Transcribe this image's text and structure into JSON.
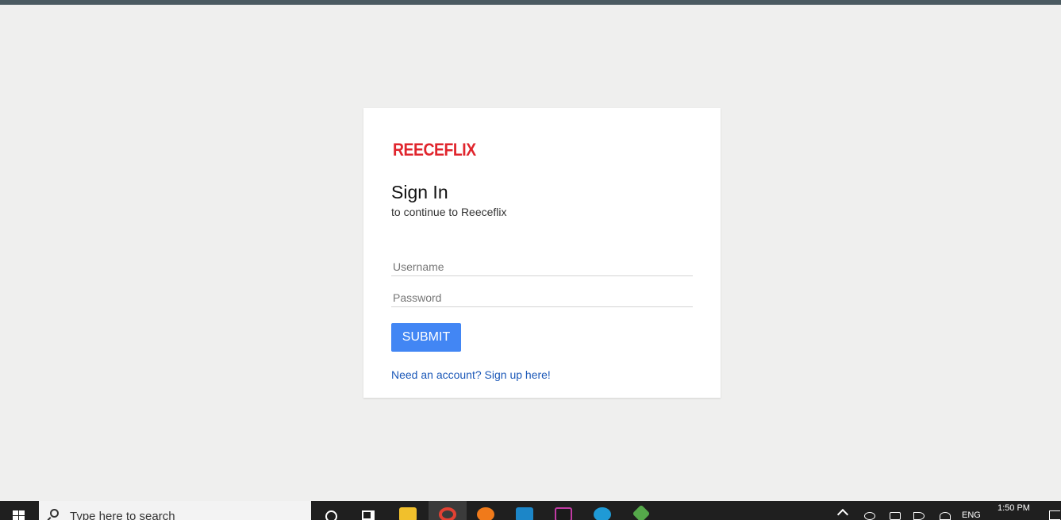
{
  "login": {
    "logo_text": "REECEFLIX",
    "title": "Sign In",
    "subtitle": "to continue to Reeceflix",
    "username_placeholder": "Username",
    "password_placeholder": "Password",
    "submit_label": "SUBMIT",
    "signup_link": "Need an account? Sign up here!"
  },
  "taskbar": {
    "search_placeholder": "Type here to search",
    "language": "ENG",
    "time": "1:50 PM",
    "apps": [
      "file-explorer-icon",
      "chrome-icon",
      "firefox-icon",
      "app-icon",
      "intellij-icon",
      "edge-icon",
      "git-icon"
    ]
  },
  "colors": {
    "brand": "#e0252d",
    "accent": "#4286f4",
    "link": "#1b58b8",
    "background": "#efefee"
  }
}
